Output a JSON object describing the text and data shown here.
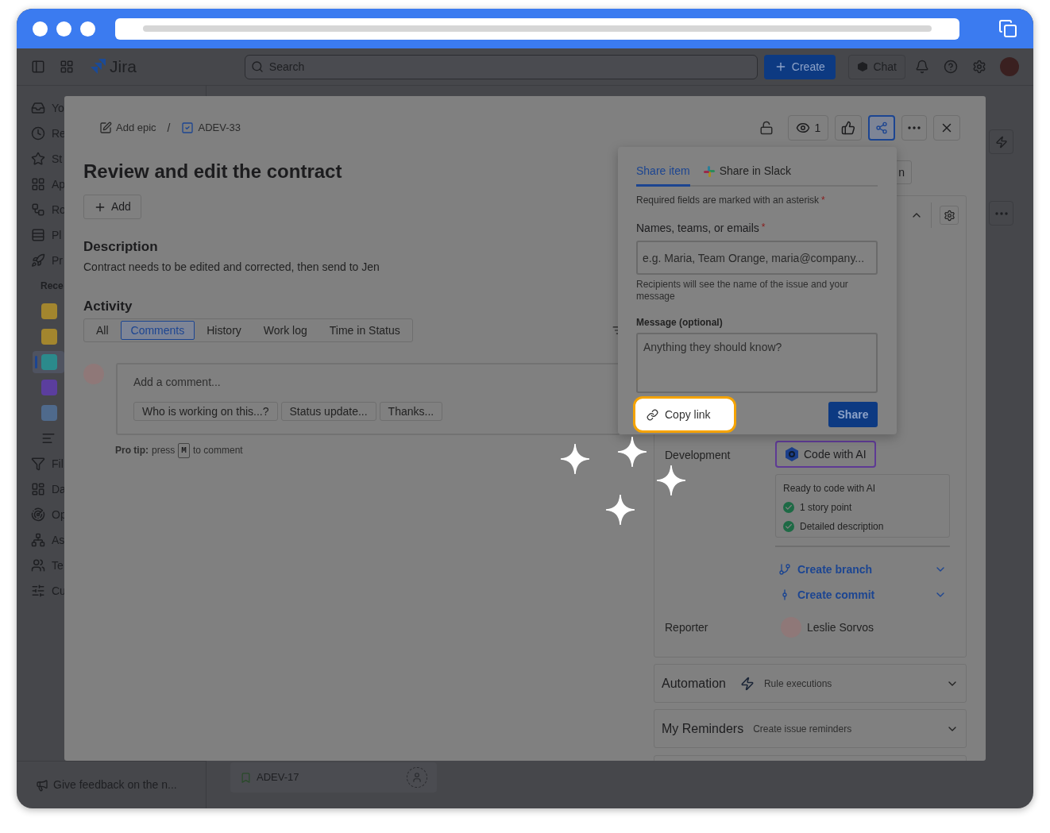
{
  "top_nav": {
    "product": "Jira",
    "search": {
      "placeholder": "Search"
    },
    "create_label": "Create",
    "chat_label": "Chat"
  },
  "sidebar": {
    "items": [
      {
        "label": "Yo"
      },
      {
        "label": "Re"
      },
      {
        "label": "St"
      },
      {
        "label": "Ap"
      },
      {
        "label": "Ro"
      },
      {
        "label": "Pl"
      },
      {
        "label": "Pr"
      }
    ],
    "recent_heading": "Rece",
    "recent": [
      {
        "kind": "project",
        "color": "#a3862e",
        "selected": false
      },
      {
        "kind": "project",
        "color": "#a3862e",
        "selected": false
      },
      {
        "kind": "project",
        "color": "#2b8a8c",
        "selected": true
      },
      {
        "kind": "project",
        "color": "#5b3e9e",
        "selected": false
      },
      {
        "kind": "project",
        "color": "#4f6a8c",
        "selected": false
      },
      {
        "kind": "view",
        "selected": false
      }
    ],
    "more_items": [
      {
        "label": "Fil"
      },
      {
        "label": "Da"
      },
      {
        "label": "Op"
      },
      {
        "label": "As"
      },
      {
        "label": "Te"
      },
      {
        "label": "Cu"
      }
    ],
    "feedback": "Give feedback on the n..."
  },
  "board_card": {
    "key": "ADEV-17"
  },
  "modal": {
    "breadcrumbs": [
      {
        "kind": "epic",
        "label": "Add epic"
      },
      {
        "kind": "task",
        "label": "ADEV-33"
      }
    ],
    "breadcrumb_separator": "/",
    "watchers": "1",
    "share_active": true,
    "title": "Review and edit the contract",
    "add_label": "Add",
    "description": {
      "heading": "Description",
      "text": "Contract needs to be edited and corrected, then send to Jen"
    },
    "activity": {
      "heading": "Activity",
      "tabs": [
        {
          "label": "All",
          "selected": false
        },
        {
          "label": "Comments",
          "selected": true
        },
        {
          "label": "History",
          "selected": false
        },
        {
          "label": "Work log",
          "selected": false
        },
        {
          "label": "Time in Status",
          "selected": false
        }
      ],
      "comment_placeholder": "Add a comment...",
      "suggestions": [
        "Who is working on this...?",
        "Status update...",
        "Thanks..."
      ],
      "pro_tip": {
        "lead": "Pro tip:",
        "before": "press",
        "key": "M",
        "after": "to comment"
      }
    },
    "share": {
      "tabs": [
        {
          "kind": "item",
          "label": "Share item",
          "selected": true
        },
        {
          "kind": "slack",
          "label": "Share in Slack",
          "selected": false
        }
      ],
      "required_note": "Required fields are marked with an asterisk",
      "note_mark": "*",
      "recipients": {
        "label": "Names, teams, or emails",
        "required_mark": "*",
        "placeholder": "e.g. Maria, Team Orange, maria@company...",
        "hint": "Recipients will see the name of the issue and your message"
      },
      "message": {
        "label": "Message (optional)",
        "placeholder": "Anything they should know?"
      },
      "copy_link": {
        "label": "Copy link",
        "highlighted": true
      },
      "share_button": "Share"
    },
    "details": {
      "partial_button": "n",
      "development": {
        "label": "Development",
        "code_ai": "Code with AI",
        "ready_title": "Ready to code with AI",
        "checks": [
          {
            "label": "1 story point",
            "done": true
          },
          {
            "label": "Detailed description",
            "done": true
          }
        ],
        "actions": [
          {
            "kind": "branch",
            "label": "Create branch"
          },
          {
            "kind": "commit",
            "label": "Create commit"
          }
        ]
      },
      "reporter": {
        "label": "Reporter",
        "name": "Leslie Sorvos"
      },
      "panels": [
        {
          "kind": "automation",
          "title": "Automation",
          "subtitle": "Rule executions"
        },
        {
          "kind": "plain",
          "title": "My Reminders",
          "subtitle": "Create issue reminders"
        }
      ]
    }
  }
}
